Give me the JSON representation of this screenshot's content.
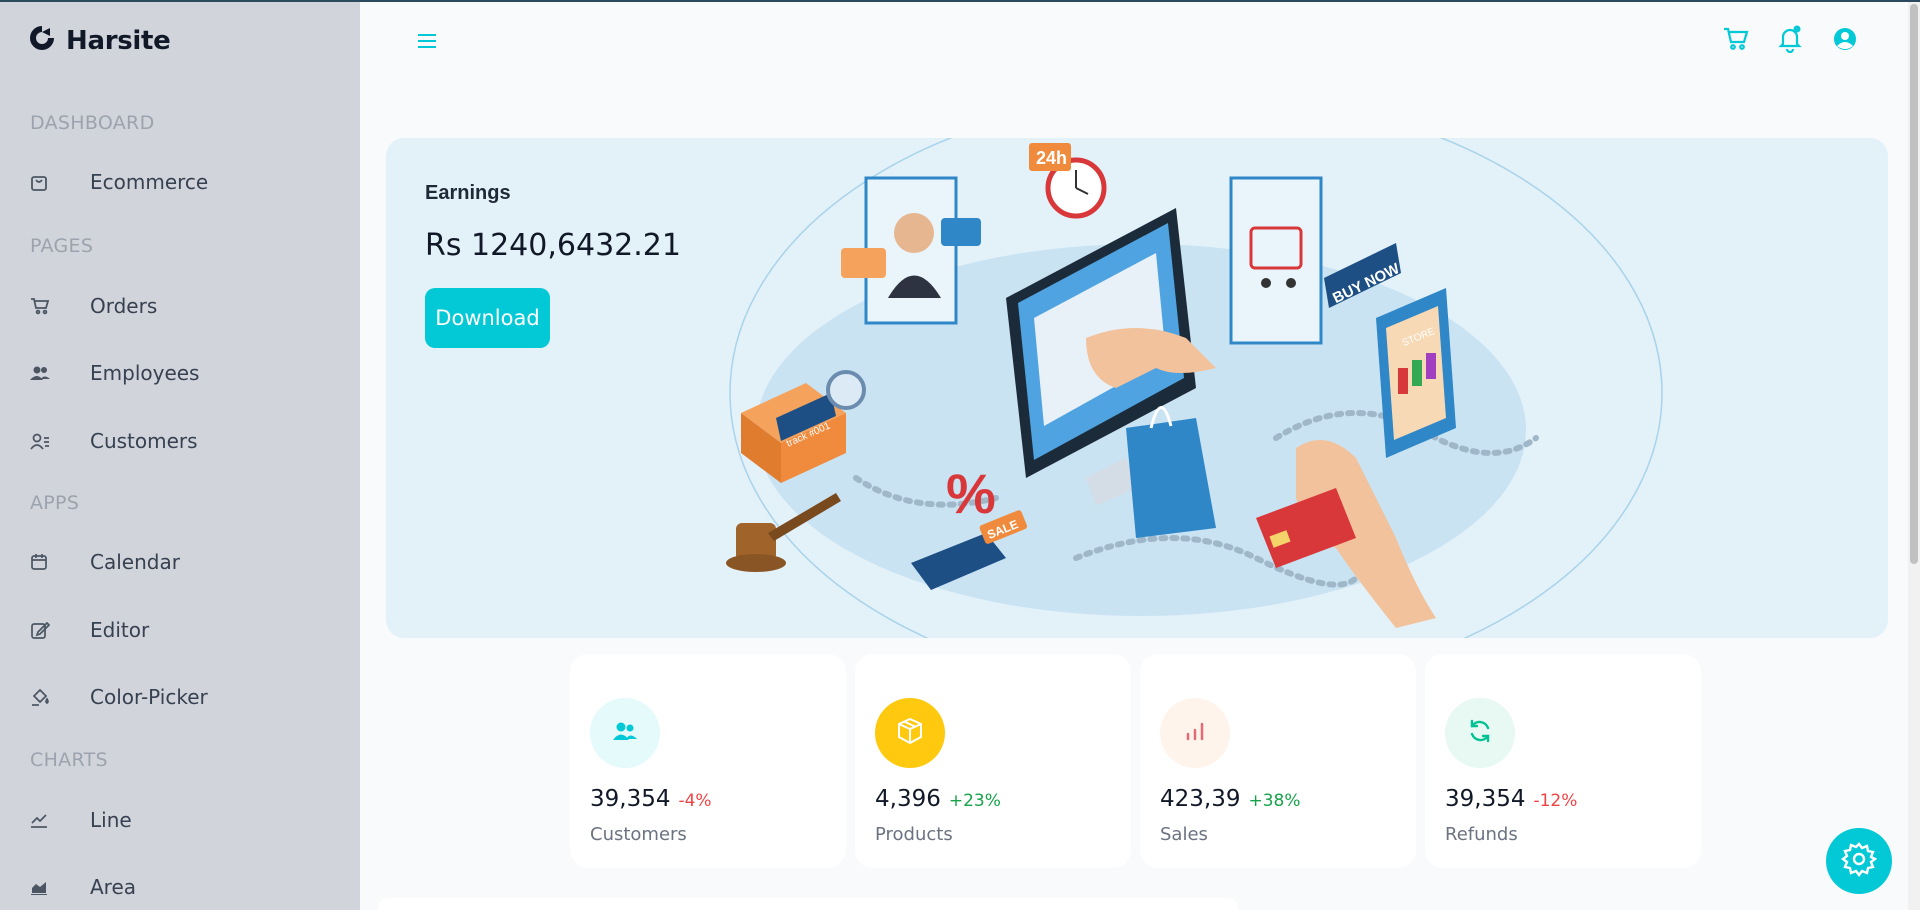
{
  "app": {
    "name": "Harsite"
  },
  "sidebar": {
    "sections": [
      {
        "title": "DASHBOARD",
        "items": [
          {
            "label": "Ecommerce",
            "icon": "shopping-bag-icon"
          }
        ]
      },
      {
        "title": "PAGES",
        "items": [
          {
            "label": "Orders",
            "icon": "cart-icon"
          },
          {
            "label": "Employees",
            "icon": "people-icon"
          },
          {
            "label": "Customers",
            "icon": "contacts-icon"
          }
        ]
      },
      {
        "title": "APPS",
        "items": [
          {
            "label": "Calendar",
            "icon": "calendar-icon"
          },
          {
            "label": "Editor",
            "icon": "edit-icon"
          },
          {
            "label": "Color-Picker",
            "icon": "paint-bucket-icon"
          }
        ]
      },
      {
        "title": "CHARTS",
        "items": [
          {
            "label": "Line",
            "icon": "line-chart-icon"
          },
          {
            "label": "Area",
            "icon": "area-chart-icon"
          }
        ]
      }
    ]
  },
  "header": {
    "icons": [
      "menu-icon",
      "cart-icon",
      "bell-icon",
      "user-icon"
    ]
  },
  "hero": {
    "title": "Earnings",
    "amount": "Rs 1240,6432.21",
    "button": "Download",
    "illustration_text": {
      "badge": "24h",
      "buy": "BUY NOW",
      "store": "STORE",
      "track": "track #001",
      "sale": "SALE"
    }
  },
  "stats": [
    {
      "value": "39,354",
      "change": "-4%",
      "label": "Customers",
      "icon": "people-icon",
      "icon_color": "#03c9d7",
      "bg": "#e5fafb"
    },
    {
      "value": "4,396",
      "change": "+23%",
      "label": "Products",
      "icon": "box-icon",
      "icon_color": "#ffffff",
      "bg": "#fec90f"
    },
    {
      "value": "423,39",
      "change": "+38%",
      "label": "Sales",
      "icon": "bar-chart-icon",
      "icon_color": "#e46a76",
      "bg": "#fff4ec"
    },
    {
      "value": "39,354",
      "change": "-12%",
      "label": "Refunds",
      "icon": "refresh-icon",
      "icon_color": "#00c292",
      "bg": "#e8f8f2"
    }
  ],
  "colors": {
    "accent": "#03c9d7",
    "sidebar": "#d1d5db",
    "hero_bg": "#e3f1f9",
    "negative": "#ef4444",
    "positive": "#16a34a"
  }
}
